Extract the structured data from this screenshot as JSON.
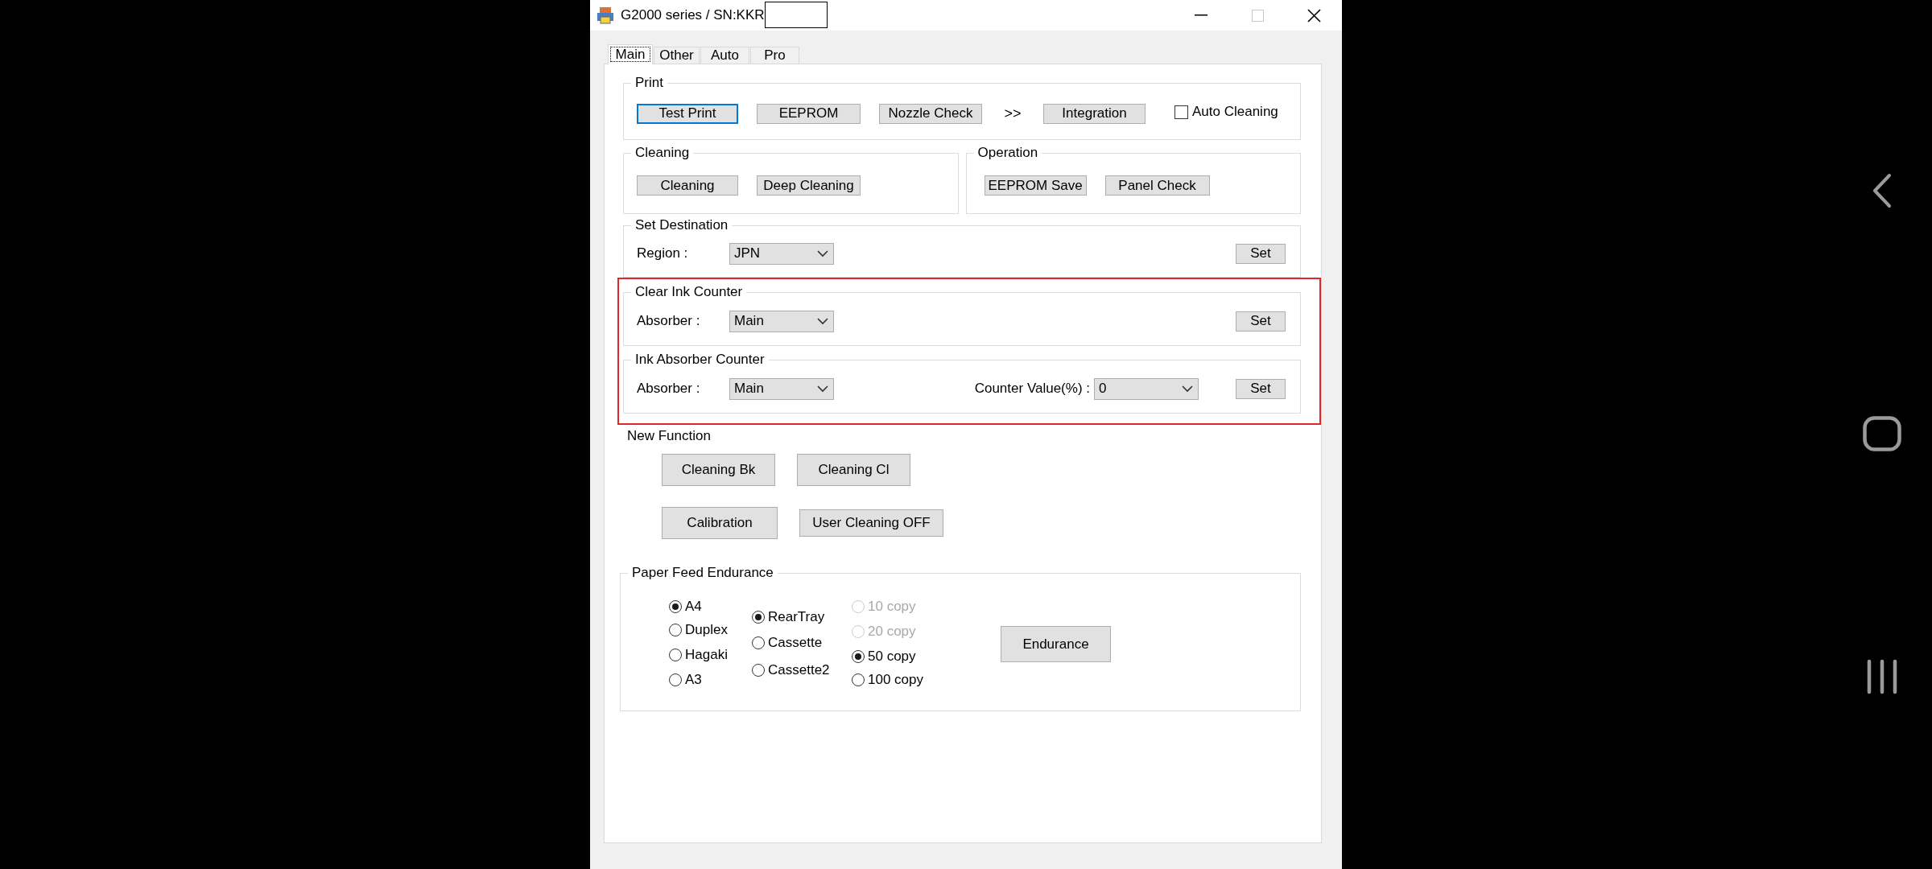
{
  "window": {
    "title": "G2000 series / SN:KKR"
  },
  "tabs": [
    {
      "label": "Main",
      "selected": true
    },
    {
      "label": "Other",
      "selected": false
    },
    {
      "label": "Auto",
      "selected": false
    },
    {
      "label": "Pro",
      "selected": false
    }
  ],
  "print": {
    "title": "Print",
    "buttons": [
      {
        "label": "Test Print",
        "focused": true
      },
      {
        "label": "EEPROM",
        "focused": false
      },
      {
        "label": "Nozzle Check",
        "focused": false
      }
    ],
    "arrows": ">>",
    "more_buttons": [
      {
        "label": "Integration",
        "focused": false
      }
    ],
    "auto_cleaning": {
      "label": "Auto Cleaning",
      "checked": false
    }
  },
  "cleaning": {
    "title": "Cleaning",
    "buttons": [
      "Cleaning",
      "Deep Cleaning"
    ]
  },
  "operation": {
    "title": "Operation",
    "buttons": [
      "EEPROM Save",
      "Panel Check"
    ]
  },
  "set_destination": {
    "title": "Set Destination",
    "label": "Region :",
    "value": "JPN",
    "button": "Set"
  },
  "highlighted_sections": [
    {
      "title": "Clear Ink Counter",
      "label": "Absorber :",
      "value": "Main",
      "button": "Set"
    },
    {
      "title": "Ink Absorber Counter",
      "label": "Absorber :",
      "value": "Main",
      "counter_label": "Counter Value(%) :",
      "counter_value": "0",
      "button": "Set"
    }
  ],
  "new_function": {
    "title": "New Function",
    "button_rows": [
      [
        "Cleaning Bk",
        "Cleaning Cl"
      ],
      [
        "Calibration",
        "User Cleaning OFF"
      ]
    ]
  },
  "paper_feed_endurance": {
    "title": "Paper Feed Endurance",
    "radio_groups": [
      [
        {
          "label": "A4",
          "selected": true,
          "disabled": false
        },
        {
          "label": "Duplex",
          "selected": false,
          "disabled": false
        },
        {
          "label": "Hagaki",
          "selected": false,
          "disabled": false
        },
        {
          "label": "A3",
          "selected": false,
          "disabled": false
        }
      ],
      [
        {
          "label": "RearTray",
          "selected": true,
          "disabled": false
        },
        {
          "label": "Cassette",
          "selected": false,
          "disabled": false
        },
        {
          "label": "Cassette2",
          "selected": false,
          "disabled": false
        }
      ],
      [
        {
          "label": "10 copy",
          "selected": false,
          "disabled": true
        },
        {
          "label": "20 copy",
          "selected": false,
          "disabled": true
        },
        {
          "label": "50 copy",
          "selected": true,
          "disabled": false
        },
        {
          "label": "100 copy",
          "selected": false,
          "disabled": false
        }
      ]
    ],
    "button": "Endurance"
  }
}
